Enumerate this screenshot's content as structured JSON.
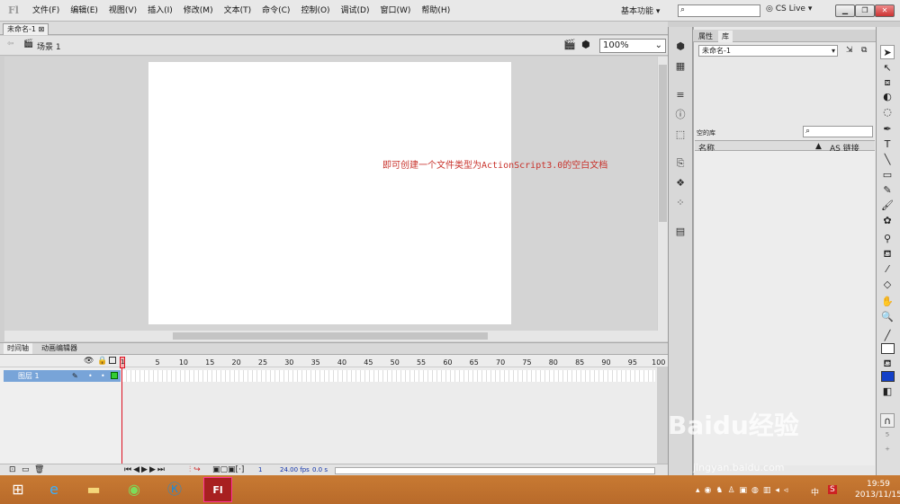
{
  "app": {
    "logo": "Fl"
  },
  "menu": [
    "文件(F)",
    "编辑(E)",
    "视图(V)",
    "插入(I)",
    "修改(M)",
    "文本(T)",
    "命令(C)",
    "控制(O)",
    "调试(D)",
    "窗口(W)",
    "帮助(H)"
  ],
  "header": {
    "workspace": "基本功能 ▾",
    "cslive": "CS Live"
  },
  "document": {
    "tab": "未命名-1",
    "scene": "场景 1",
    "zoom": "100%"
  },
  "annotation": "即可创建一个文件类型为ActionScript3.0的空白文档",
  "timeline": {
    "tabs": [
      "时间轴",
      "动画编辑器"
    ],
    "frame_numbers": [
      "5",
      "10",
      "15",
      "20",
      "25",
      "30",
      "35",
      "40",
      "45",
      "50",
      "55",
      "60",
      "65",
      "70",
      "75",
      "80",
      "85",
      "90",
      "95",
      "100"
    ],
    "layer_name": "图层 1",
    "playhead": "1",
    "footer": {
      "frame": "1",
      "fps": "24.00 fps",
      "time": "0.0 s"
    }
  },
  "panel": {
    "tabs": [
      "属性",
      "库"
    ],
    "doc_select": "未命名-1",
    "lib_label": "空的库",
    "col_name": "名称",
    "col_link": "AS 链接"
  },
  "taskbar": {
    "time": "19:59",
    "date": "2013/11/15",
    "ime": "中"
  },
  "watermark": {
    "brand": "Baidu经验",
    "url": "jingyan.baidu.com"
  },
  "colors": {
    "annotation": "#c8322b",
    "layer_highlight": "#78a4d8",
    "taskbar": "#c87a33",
    "playhead": "#dd1122"
  }
}
